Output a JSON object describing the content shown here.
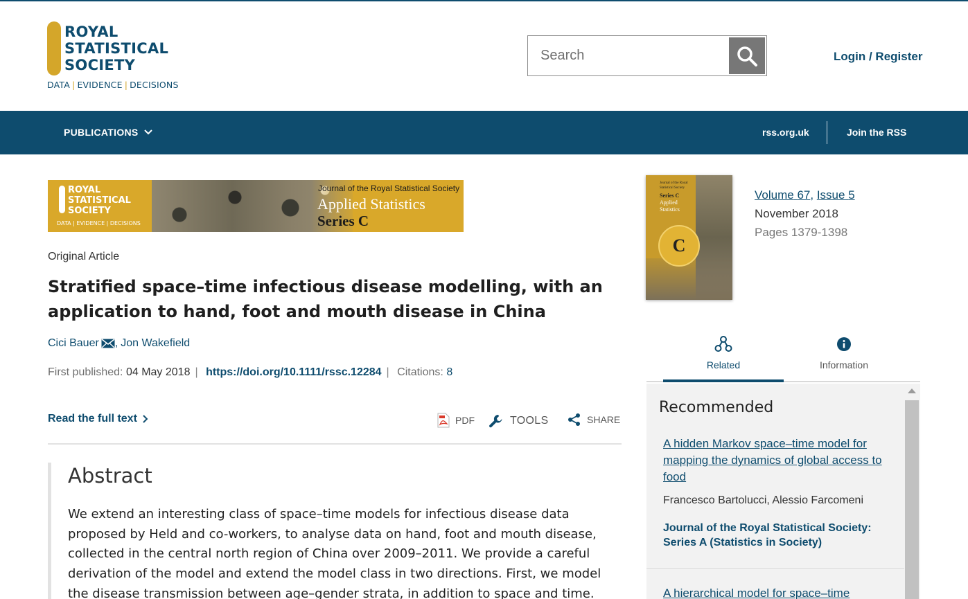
{
  "header": {
    "logo": {
      "line1": "ROYAL",
      "line2": "STATISTICAL",
      "line3": "SOCIETY",
      "tag1": "DATA",
      "tag2": "EVIDENCE",
      "tag3": "DECISIONS"
    },
    "search": {
      "placeholder": "Search"
    },
    "login_label": "Login / Register"
  },
  "nav": {
    "publications_label": "PUBLICATIONS",
    "rss_label": "rss.org.uk",
    "join_label": "Join the RSS"
  },
  "banner": {
    "logo_line1": "ROYAL",
    "logo_line2": "STATISTICAL",
    "logo_line3": "SOCIETY",
    "logo_tag": "DATA | EVIDENCE | DECISIONS",
    "journal": "Journal of the Royal Statistical Society",
    "title": "Applied Statistics",
    "series": "Series C"
  },
  "article": {
    "type": "Original Article",
    "title": "Stratified space–time infectious disease modelling, with an application to hand, foot and mouth disease in China",
    "authors": [
      "Cici Bauer",
      "Jon Wakefield"
    ],
    "first_published_label": "First published:",
    "first_published_date": "04 May 2018",
    "doi": "https://doi.org/10.1111/rssc.12284",
    "citations_label": "Citations:",
    "citations_count": "8",
    "read_full_text": "Read the full text",
    "tools": {
      "pdf": "PDF",
      "tools": "TOOLS",
      "share": "SHARE"
    },
    "abstract_heading": "Abstract",
    "abstract_text": "We extend an interesting class of space–time models for infectious disease data proposed by Held and co-workers, to analyse data on hand, foot and mouth disease, collected in the central north region of China over 2009–2011. We provide a careful derivation of the model and extend the model class in two directions. First, we model the disease transmission between age–gender strata, in addition to space and time. Second,"
  },
  "issue": {
    "volume_label": "Volume",
    "volume_number": "67",
    "issue_label": "Issue",
    "issue_number": "5",
    "date": "November 2018",
    "pages": "Pages 1379-1398",
    "cover": {
      "journal": "Journal of the Royal Statistical Society",
      "series": "Series C",
      "title_line1": "Applied",
      "title_line2": "Statistics",
      "badge_letter": "C"
    }
  },
  "sidebar": {
    "tabs": [
      {
        "label": "Related",
        "icon": "related-icon"
      },
      {
        "label": "Information",
        "icon": "info-icon"
      }
    ],
    "recommended_heading": "Recommended",
    "items": [
      {
        "title": "A hidden Markov space–time model for mapping the dynamics of global access to food",
        "authors": "Francesco Bartolucci, Alessio Farcomeni",
        "journal": "Journal of the Royal Statistical Society: Series A (Statistics in Society)"
      },
      {
        "title": "A hierarchical model for space–time"
      }
    ]
  },
  "colors": {
    "brand_blue": "#0e4c6e",
    "brand_gold": "#d4a62a",
    "panel_gray": "#f2f2f2"
  }
}
